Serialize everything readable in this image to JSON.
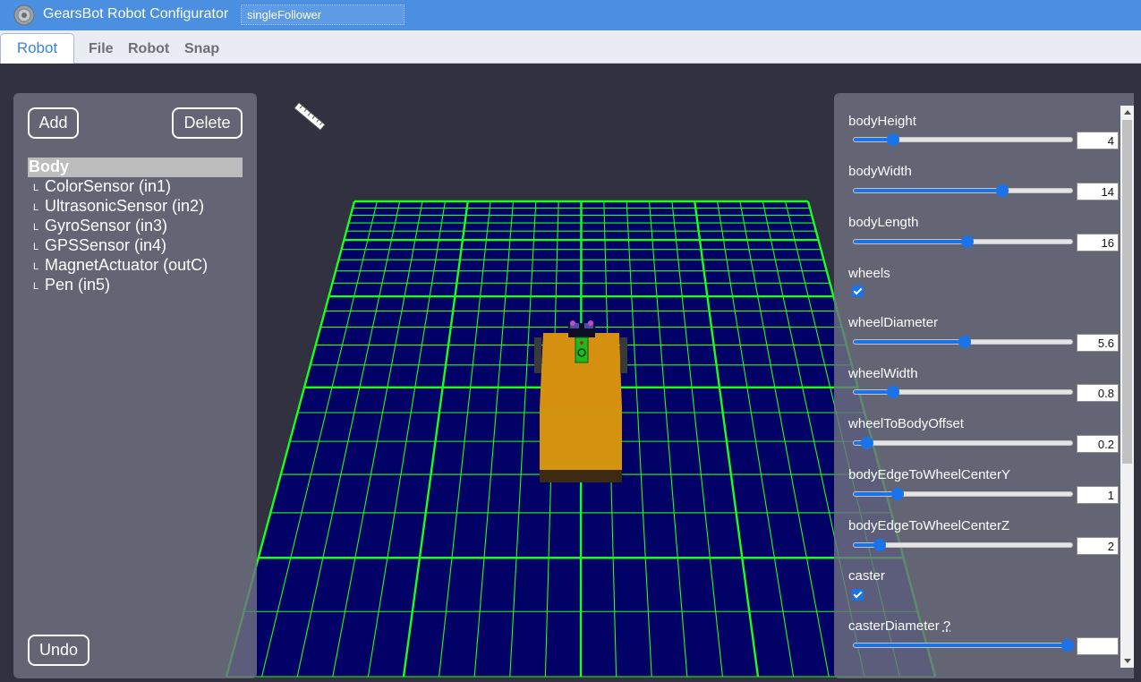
{
  "app": {
    "title": "GearsBot Robot Configurator",
    "filename": "singleFollower",
    "logo_icon": "gear-icon"
  },
  "menu": {
    "active_tab": "Robot",
    "items": [
      "File",
      "Robot",
      "Snap"
    ]
  },
  "left_panel": {
    "add_label": "Add",
    "delete_label": "Delete",
    "undo_label": "Undo",
    "components": [
      {
        "label": "Body",
        "selected": true
      },
      {
        "label": "ColorSensor (in1)"
      },
      {
        "label": "UltrasonicSensor (in2)"
      },
      {
        "label": "GyroSensor (in3)"
      },
      {
        "label": "GPSSensor (in4)"
      },
      {
        "label": "MagnetActuator (outC)"
      },
      {
        "label": "Pen (in5)"
      }
    ],
    "branch_glyph": "L"
  },
  "scene": {
    "ruler_icon": "ruler-icon",
    "grid_color": "#1aff1a",
    "floor_color": "#000066",
    "robot_body_color": "#d4900e"
  },
  "params": [
    {
      "name": "bodyHeight",
      "type": "slider",
      "value": "4",
      "fraction": 0.18
    },
    {
      "name": "bodyWidth",
      "type": "slider",
      "value": "14",
      "fraction": 0.68
    },
    {
      "name": "bodyLength",
      "type": "slider",
      "value": "16",
      "fraction": 0.52
    },
    {
      "name": "wheels",
      "type": "checkbox",
      "checked": true
    },
    {
      "name": "wheelDiameter",
      "type": "slider",
      "value": "5.6",
      "fraction": 0.51
    },
    {
      "name": "wheelWidth",
      "type": "slider",
      "value": "0.8",
      "fraction": 0.18
    },
    {
      "name": "wheelToBodyOffset",
      "type": "slider",
      "value": "0.2",
      "fraction": 0.06
    },
    {
      "name": "bodyEdgeToWheelCenterY",
      "type": "slider",
      "value": "1",
      "fraction": 0.2
    },
    {
      "name": "bodyEdgeToWheelCenterZ",
      "type": "slider",
      "value": "2",
      "fraction": 0.12
    },
    {
      "name": "caster",
      "type": "checkbox",
      "checked": true
    },
    {
      "name": "casterDiameter",
      "help": "?",
      "type": "slider",
      "value": "",
      "fraction": 0.98
    }
  ],
  "colors": {
    "titlebar": "#4a8fe0",
    "accent": "#1a73e8"
  }
}
